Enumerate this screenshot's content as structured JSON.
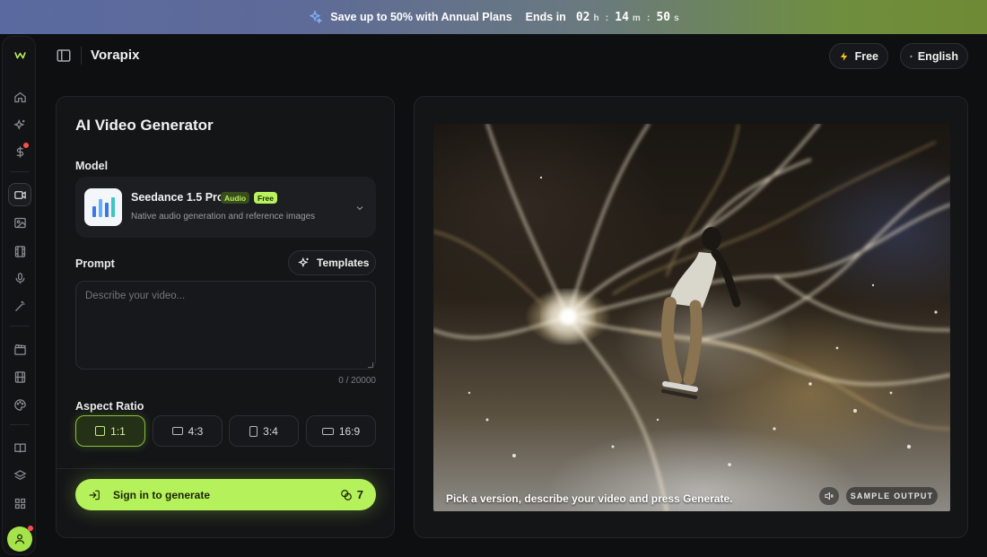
{
  "promo": {
    "text": "Save up to 50% with Annual Plans",
    "ends_label": "Ends in",
    "hours": "02",
    "hours_unit": "h",
    "minutes": "14",
    "minutes_unit": "m",
    "seconds": "50",
    "seconds_unit": "s",
    "separator": ":"
  },
  "header": {
    "brand": "Vorapix",
    "plan_label": "Free",
    "language_label": "English"
  },
  "sidebar": {
    "items": [
      {
        "name": "home",
        "icon": "home-icon"
      },
      {
        "name": "explore",
        "icon": "sparkle-icon"
      },
      {
        "name": "pricing",
        "icon": "dollar-icon",
        "has_notification": true
      },
      {
        "name": "video",
        "icon": "video-icon",
        "active": true
      },
      {
        "name": "image",
        "icon": "image-icon"
      },
      {
        "name": "film",
        "icon": "film-icon"
      },
      {
        "name": "audio",
        "icon": "mic-icon"
      },
      {
        "name": "magic",
        "icon": "magic-wand-icon"
      },
      {
        "name": "clapper",
        "icon": "clapperboard-icon"
      },
      {
        "name": "library",
        "icon": "film-strip-icon"
      },
      {
        "name": "palette",
        "icon": "palette-icon"
      },
      {
        "name": "docs",
        "icon": "book-icon"
      },
      {
        "name": "layers",
        "icon": "layers-icon"
      },
      {
        "name": "apps",
        "icon": "grid-icon"
      }
    ]
  },
  "generator": {
    "title": "AI Video Generator",
    "model_label": "Model",
    "model": {
      "name": "Seedance 1.5 Pro",
      "badge_audio": "Audio",
      "badge_free": "Free",
      "description": "Native audio generation and reference images"
    },
    "prompt_label": "Prompt",
    "templates_label": "Templates",
    "prompt_placeholder": "Describe your video...",
    "prompt_value": "",
    "char_counter": "0 / 20000",
    "aspect_label": "Aspect Ratio",
    "aspect_options": [
      "1:1",
      "4:3",
      "3:4",
      "16:9"
    ],
    "aspect_selected": "1:1",
    "cta_label": "Sign in to generate",
    "credits": "7"
  },
  "preview": {
    "caption": "Pick a version, describe your video and press Generate.",
    "sample_label": "SAMPLE OUTPUT"
  },
  "colors": {
    "accent": "#b5f15a",
    "background": "#0e0f11",
    "panel": "#141517",
    "notification": "#ff4b4b"
  }
}
